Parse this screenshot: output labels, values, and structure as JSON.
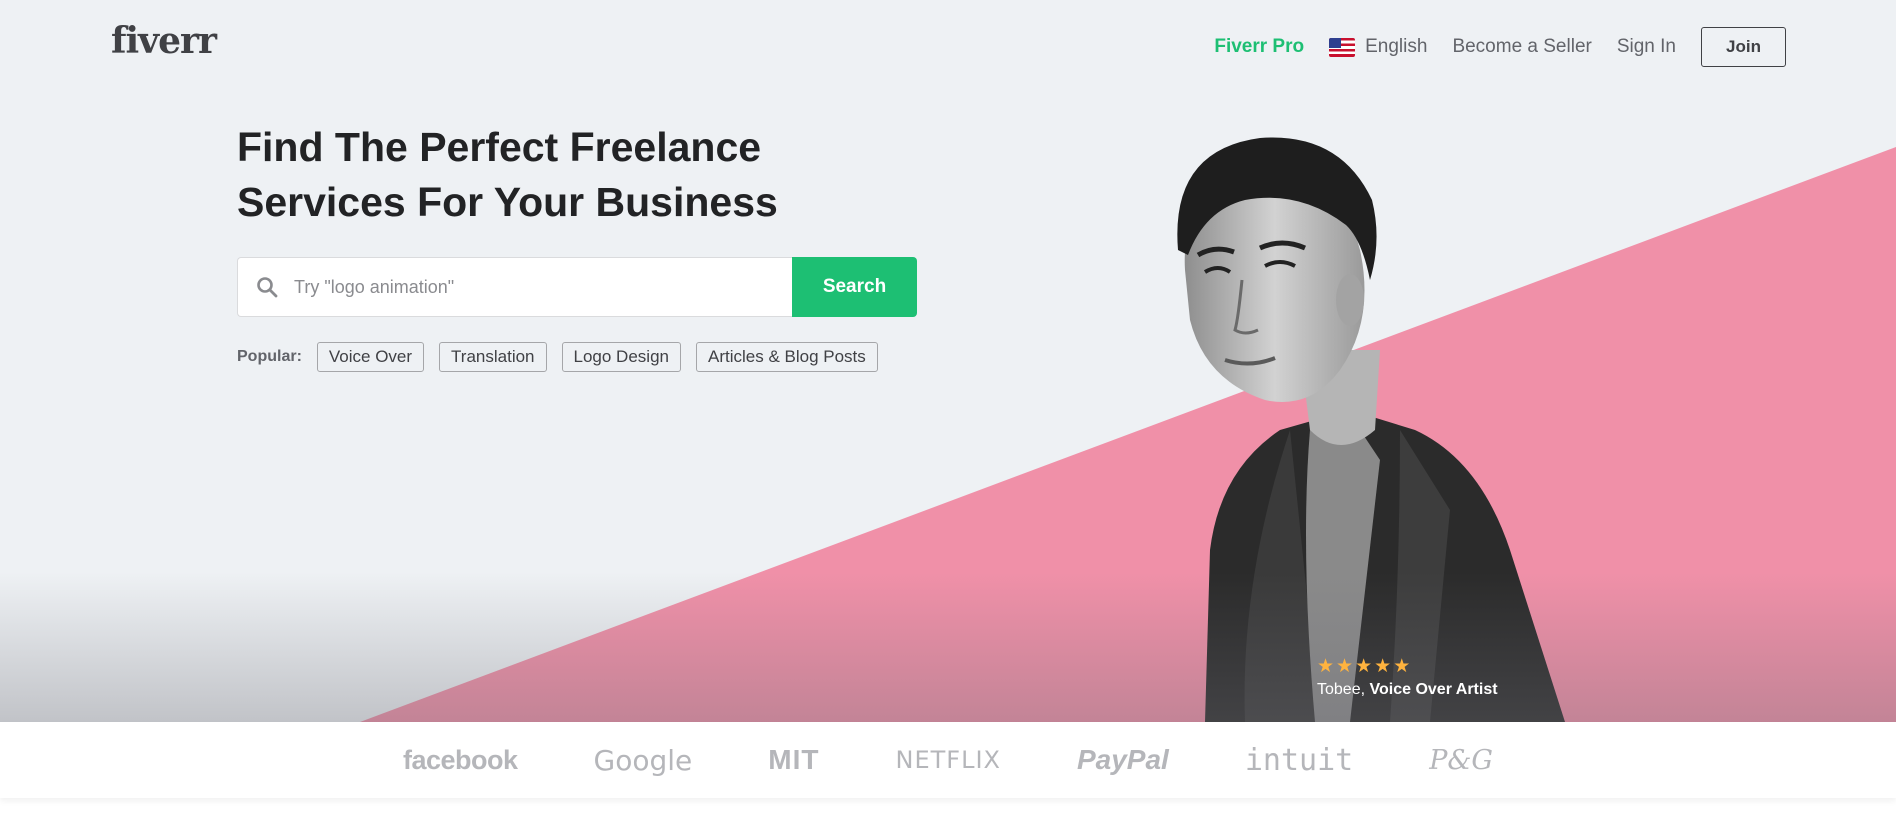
{
  "header": {
    "logo": "fiverr",
    "nav": {
      "pro": "Fiverr Pro",
      "language": "English",
      "become_seller": "Become a Seller",
      "sign_in": "Sign In",
      "join": "Join"
    }
  },
  "hero": {
    "headline_line1": "Find The Perfect Freelance",
    "headline_line2": "Services For Your Business",
    "search": {
      "placeholder": "Try \"logo animation\"",
      "button": "Search",
      "icon": "search-icon"
    },
    "popular": {
      "label": "Popular:",
      "tags": [
        "Voice Over",
        "Translation",
        "Logo Design",
        "Articles & Blog Posts"
      ]
    },
    "featured": {
      "rating_stars": 5,
      "name": "Tobee,",
      "role": "Voice Over Artist"
    }
  },
  "trusted_by": [
    "facebook",
    "Google",
    "MIT",
    "NETFLIX",
    "PayPal",
    "intuit",
    "P&G"
  ],
  "colors": {
    "brand_green": "#1dbf73",
    "hero_bg": "#eef1f4",
    "hero_pink": "#f090a8",
    "logo_gray": "#b5b6ba",
    "star": "#ffb33e"
  }
}
